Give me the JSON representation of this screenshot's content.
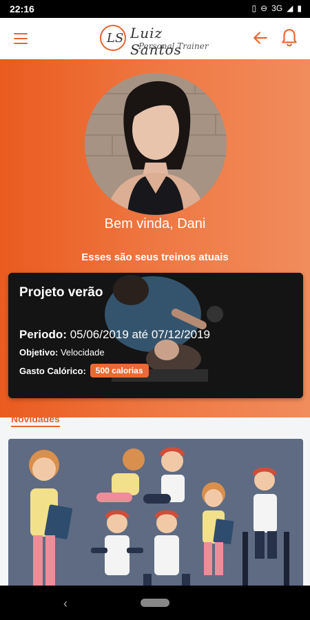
{
  "status_bar": {
    "time": "22:16",
    "network": "3G"
  },
  "header": {
    "logo_initials": "LS",
    "logo_name": "Luiz Santos",
    "logo_subtitle": "Personal Trainer",
    "menu_icon": "hamburger-menu-icon",
    "back_icon": "arrow-left-icon",
    "notifications_icon": "bell-icon"
  },
  "profile": {
    "welcome": "Bem vinda, Dani",
    "current_workouts_label": "Esses são seus treinos atuais"
  },
  "workout_card": {
    "title": "Projeto verão",
    "period_label": "Periodo:",
    "period_value": "05/06/2019 até 07/12/2019",
    "objective_label": "Objetivo:",
    "objective_value": "Velocidade",
    "calories_label": "Gasto Calórico:",
    "calories_value": "500 calorias"
  },
  "news": {
    "title": "Novidades"
  },
  "colors": {
    "accent": "#e8642c",
    "hero_start": "#ea5b1f",
    "hero_end": "#f18c5c",
    "news_bg": "#5e6b83"
  }
}
